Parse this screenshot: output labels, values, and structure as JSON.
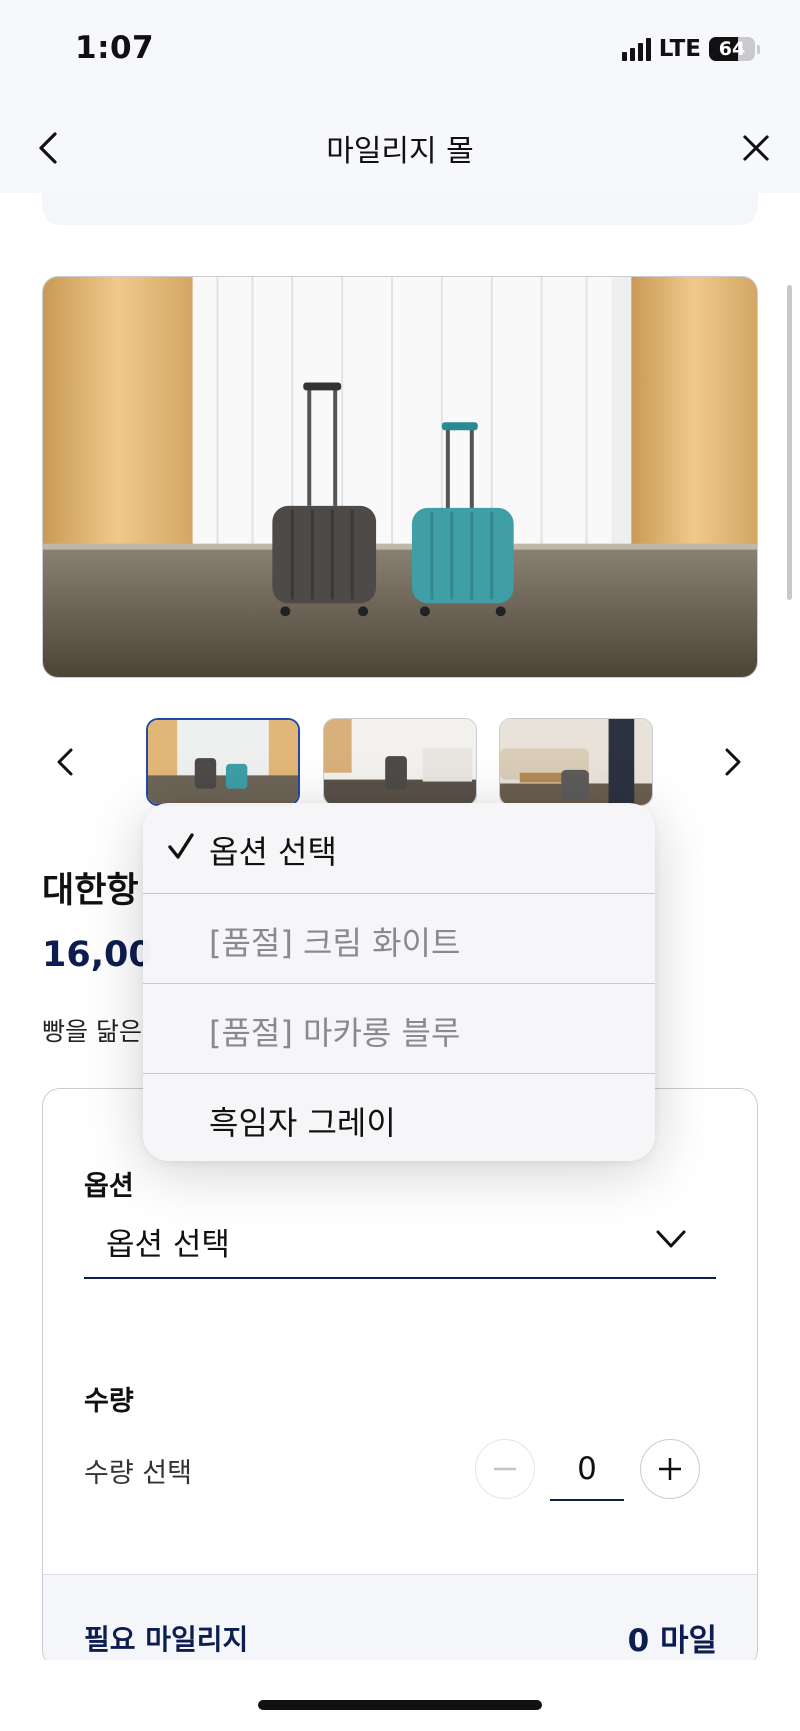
{
  "status_bar": {
    "time": "1:07",
    "network": "LTE",
    "battery": "64",
    "battery_level": 0.64
  },
  "nav": {
    "title": "마일리지 몰"
  },
  "product": {
    "title": "대한항",
    "price": "16,00",
    "desc": "빵을 닮은"
  },
  "option": {
    "label": "옵션",
    "selected": "옵션 선택"
  },
  "quantity": {
    "label": "수량",
    "sub_label": "수량 선택",
    "value": "0"
  },
  "mileage": {
    "label": "필요 마일리지",
    "value": "0 마일"
  },
  "dropdown": {
    "items": [
      {
        "label": "옵션 선택",
        "checked": true,
        "disabled": false
      },
      {
        "label": "[품절] 크림 화이트",
        "checked": false,
        "disabled": true
      },
      {
        "label": "[품절] 마카롱 블루",
        "checked": false,
        "disabled": true
      },
      {
        "label": "흑임자 그레이",
        "checked": false,
        "disabled": false
      }
    ]
  },
  "icons": {
    "back": "chevron-left-icon",
    "close": "close-icon",
    "select": "chevron-down-icon",
    "minus": "minus-icon",
    "plus": "plus-icon",
    "check": "checkmark-icon"
  },
  "colors": {
    "navy": "#0d1d4f",
    "active_thumb_border": "#1f4aa8"
  }
}
